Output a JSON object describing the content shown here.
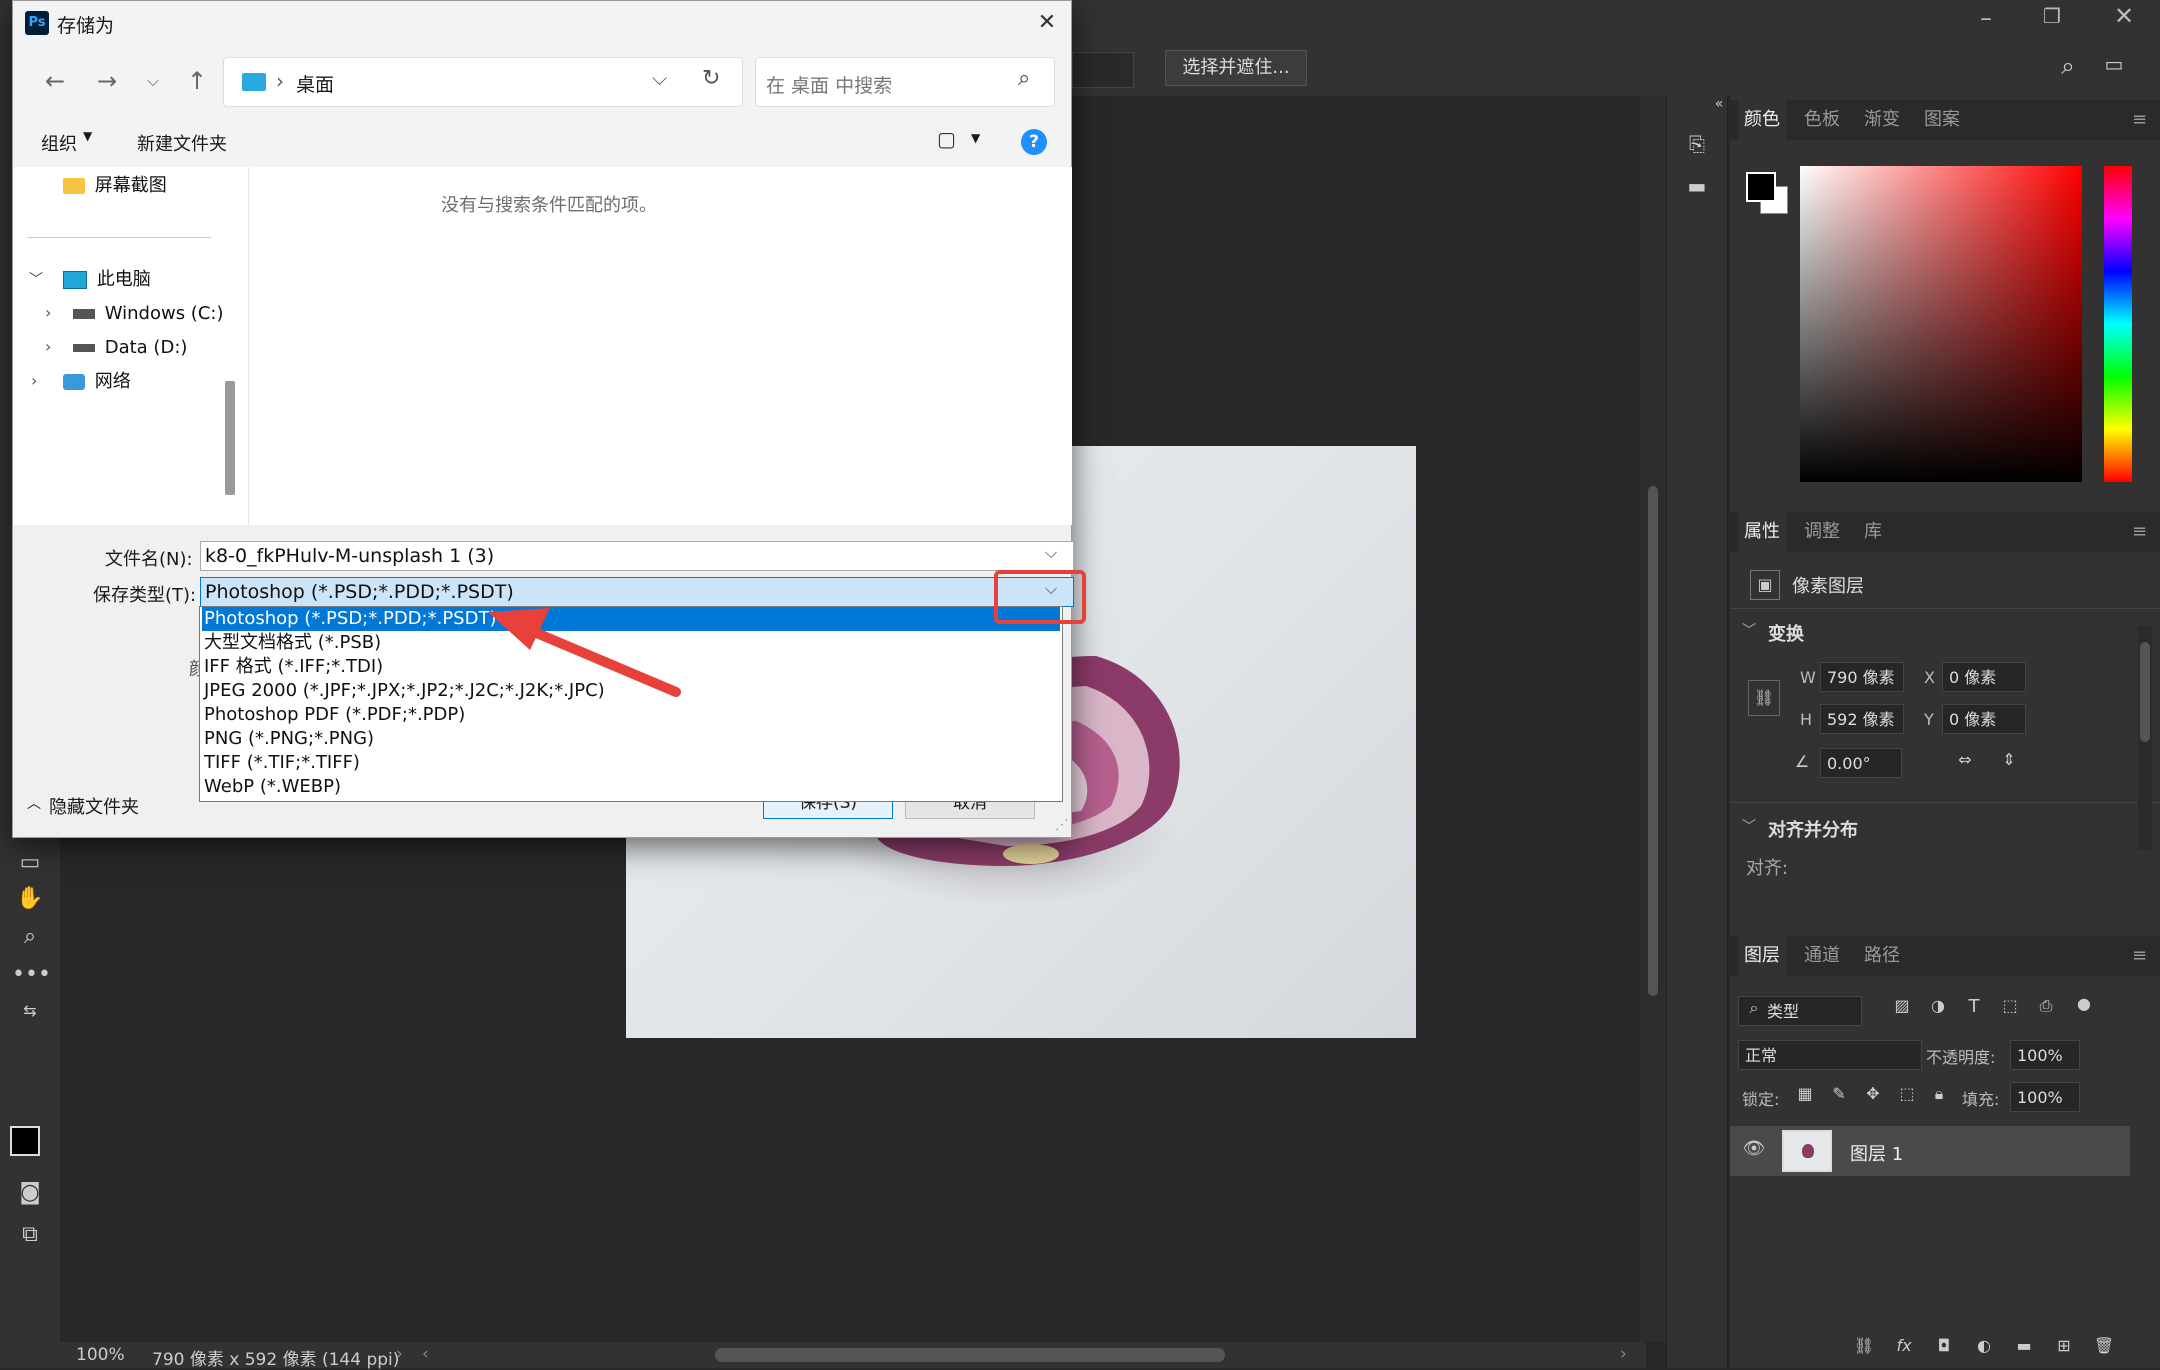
{
  "ps": {
    "options_bar": {
      "select_mask_label": "选择并遮住..."
    },
    "status": {
      "zoom": "100%",
      "doc_info": "790 像素 x 592 像素 (144 ppi)"
    },
    "panels": {
      "color_tabs": [
        "颜色",
        "色板",
        "渐变",
        "图案"
      ],
      "props_tabs": [
        "属性",
        "调整",
        "库"
      ],
      "layer_type_label": "像素图层",
      "transform": {
        "title": "变换",
        "w_label": "W",
        "w_value": "790 像素",
        "h_label": "H",
        "h_value": "592 像素",
        "x_label": "X",
        "x_value": "0 像素",
        "y_label": "Y",
        "y_value": "0 像素",
        "angle_value": "0.00°"
      },
      "align": {
        "title": "对齐并分布",
        "label": "对齐:"
      },
      "layers_tabs": [
        "图层",
        "通道",
        "路径"
      ],
      "layers": {
        "filter_type": "类型",
        "blend_mode": "正常",
        "opacity_label": "不透明度:",
        "opacity_value": "100%",
        "lock_label": "锁定:",
        "fill_label": "填充:",
        "fill_value": "100%",
        "items": [
          {
            "name": "图层 1"
          }
        ]
      }
    },
    "colors": {
      "bg": "#282828",
      "panel": "#323232",
      "accent": "#0078d7"
    }
  },
  "dialog": {
    "app_icon_text": "Ps",
    "title": "存储为",
    "path_segment": "桌面",
    "search_placeholder": "在 桌面 中搜索",
    "organize_label": "组织",
    "new_folder_label": "新建文件夹",
    "sidebar": {
      "items": [
        {
          "label": "屏幕截图",
          "icon": "folder-icon"
        },
        {
          "label": "此电脑",
          "icon": "computer-icon"
        },
        {
          "label": "Windows (C:)",
          "icon": "drive-icon"
        },
        {
          "label": "Data (D:)",
          "icon": "drive-icon"
        },
        {
          "label": "网络",
          "icon": "network-icon"
        }
      ]
    },
    "empty_message": "没有与搜索条件匹配的项。",
    "filename_label": "文件名(N):",
    "filename_value": "k8-0_fkPHulv-M-unsplash 1 (3)",
    "savetype_label": "保存类型(T):",
    "savetype_value": "Photoshop (*.PSD;*.PDD;*.PSDT)",
    "savetype_options": [
      "Photoshop (*.PSD;*.PDD;*.PSDT)",
      "大型文档格式 (*.PSB)",
      "IFF 格式 (*.IFF;*.TDI)",
      "JPEG 2000 (*.JPF;*.JPX;*.JP2;*.J2C;*.J2K;*.JPC)",
      "Photoshop PDF (*.PDF;*.PDP)",
      "PNG (*.PNG;*.PNG)",
      "TIFF (*.TIF;*.TIFF)",
      "WebP (*.WEBP)"
    ],
    "hidden_col_text": "颜",
    "save_button": "保存(S)",
    "cancel_button": "取消",
    "hide_folders_label": "隐藏文件夹"
  }
}
